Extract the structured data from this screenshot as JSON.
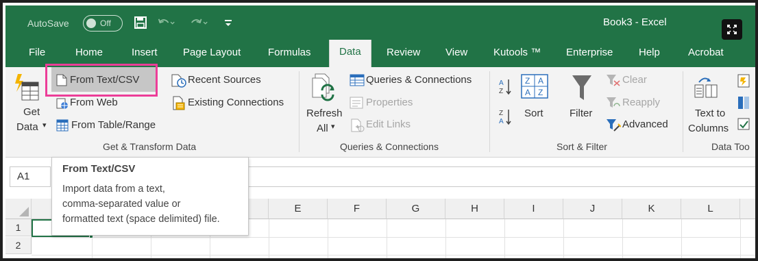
{
  "titlebar": {
    "autosave_label": "AutoSave",
    "autosave_state": "Off",
    "title": "Book3 - Excel"
  },
  "tabs": [
    "File",
    "Home",
    "Insert",
    "Page Layout",
    "Formulas",
    "Data",
    "Review",
    "View",
    "Kutools ™",
    "Enterprise",
    "Help",
    "Acrobat"
  ],
  "active_tab": "Data",
  "ribbon": {
    "get_transform": {
      "get_data": "Get",
      "get_data2": "Data",
      "from_text_csv": "From Text/CSV",
      "from_web": "From Web",
      "from_table_range": "From Table/Range",
      "recent_sources": "Recent Sources",
      "existing_connections": "Existing Connections",
      "label": "Get & Transform Data"
    },
    "queries": {
      "refresh": "Refresh",
      "refresh_all": "All",
      "queries_connections": "Queries & Connections",
      "properties": "Properties",
      "edit_links": "Edit Links",
      "label": "Queries & Connections"
    },
    "sort_filter": {
      "sort": "Sort",
      "filter": "Filter",
      "clear": "Clear",
      "reapply": "Reapply",
      "advanced": "Advanced",
      "label": "Sort & Filter"
    },
    "data_tools": {
      "text_to": "Text to",
      "columns": "Columns",
      "label": "Data Too"
    }
  },
  "namebox": "A1",
  "grid": {
    "columns": [
      "E",
      "F",
      "G",
      "H",
      "I",
      "J",
      "K",
      "L"
    ],
    "rows": [
      "1",
      "2"
    ]
  },
  "tooltip": {
    "title": "From Text/CSV",
    "lines": [
      "Import data from a text,",
      "comma-separated value or",
      "formatted text (space delimited) file."
    ]
  },
  "colors": {
    "excel_green": "#217346",
    "highlight": "#ec3d98",
    "ribbon_bg": "#f3f3f3"
  }
}
